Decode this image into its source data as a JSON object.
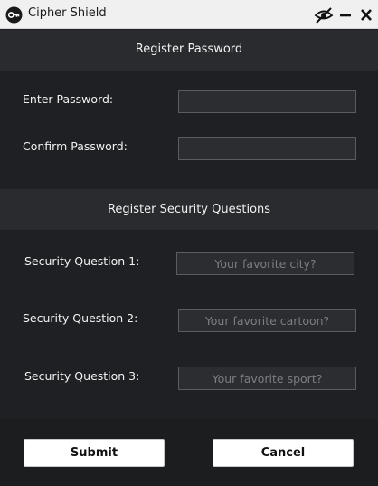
{
  "window": {
    "title": "Cipher Shield",
    "icons": {
      "app": "key-icon",
      "visibility": "eye-off-icon",
      "minimize": "minimize-icon",
      "close": "close-icon"
    }
  },
  "register_password": {
    "header": "Register Password",
    "enter_label": "Enter Password:",
    "enter_value": "",
    "confirm_label": "Confirm Password:",
    "confirm_value": ""
  },
  "security_questions": {
    "header": "Register Security Questions",
    "questions": [
      {
        "label": "Security Question 1:",
        "placeholder": "Your favorite city?",
        "value": ""
      },
      {
        "label": "Security Question 2:",
        "placeholder": "Your favorite cartoon?",
        "value": ""
      },
      {
        "label": "Security Question 3:",
        "placeholder": "Your favorite sport?",
        "value": ""
      }
    ]
  },
  "actions": {
    "submit": "Submit",
    "cancel": "Cancel"
  },
  "colors": {
    "background": "#1f2023",
    "section_header": "#2a2b2e",
    "button": "#ffffff"
  }
}
